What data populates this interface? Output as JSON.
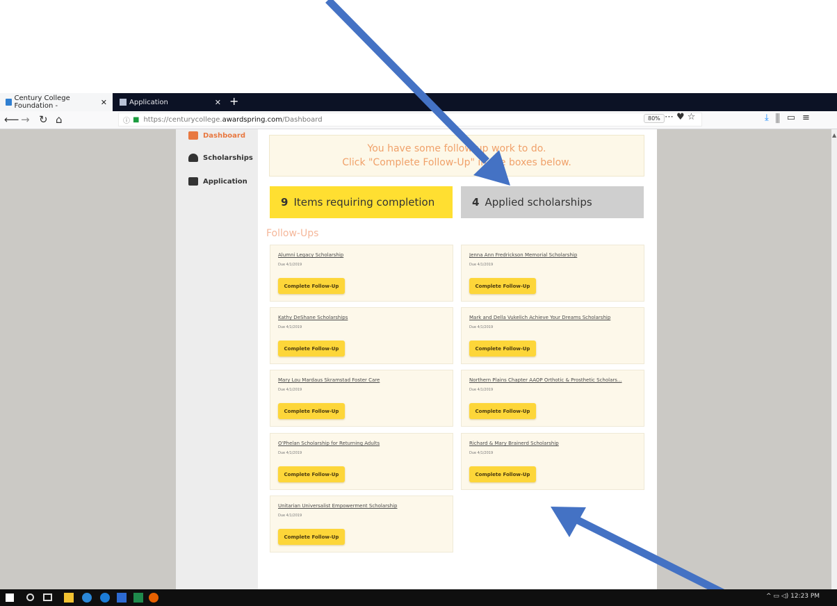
{
  "browser": {
    "tabs": [
      {
        "label": "Century College Foundation -",
        "close": "✕"
      },
      {
        "label": "Application",
        "close": "✕"
      }
    ],
    "new_tab": "+",
    "url_prefix": "https://centurycollege.",
    "url_host": "awardspring.com",
    "url_path": "/Dashboard",
    "zoom": "80%",
    "accent": "#0a84ff"
  },
  "sidebar": {
    "items": [
      {
        "label": "Dashboard",
        "icon": "dashboard-icon"
      },
      {
        "label": "Scholarships",
        "icon": "scholarships-icon"
      },
      {
        "label": "Application",
        "icon": "application-icon"
      }
    ]
  },
  "notice": {
    "line1": "You have some follow-up work to do.",
    "line2": "Click \"Complete Follow-Up\" in the boxes below."
  },
  "stats": [
    {
      "number": "9",
      "label": "Items requiring completion",
      "color": "#ffdf31"
    },
    {
      "number": "4",
      "label": "Applied scholarships",
      "color": "#cfcfcf"
    }
  ],
  "followups": {
    "title": "Follow-Ups",
    "button_label": "Complete Follow-Up",
    "cards": [
      {
        "title": "Alumni Legacy Scholarship",
        "due": "Due 4/1/2019"
      },
      {
        "title": "Jenna Ann Fredrickson Memorial Scholarship",
        "due": "Due 4/1/2019"
      },
      {
        "title": "Kathy DeShane Scholarships",
        "due": "Due 4/1/2019"
      },
      {
        "title": "Mark and Della Vukelich Achieve Your Dreams Scholarship",
        "due": "Due 4/1/2019"
      },
      {
        "title": "Mary Lou Mardaus Skramstad Foster Care",
        "due": "Due 4/1/2019"
      },
      {
        "title": "Northern Plains Chapter AAOP Orthotic & Prosthetic Scholars...",
        "due": "Due 4/1/2019"
      },
      {
        "title": "O'Phelan Scholarship for Returning Adults",
        "due": "Due 4/1/2019"
      },
      {
        "title": "Richard & Mary Brainerd Scholarship",
        "due": "Due 4/1/2019"
      },
      {
        "title": "Unitarian Universalist Empowerment Scholarship",
        "due": "Due 4/1/2019"
      }
    ]
  },
  "taskbar": {
    "clock": "12:23 PM",
    "tray_glyphs": "^ ▭ ◁)"
  }
}
